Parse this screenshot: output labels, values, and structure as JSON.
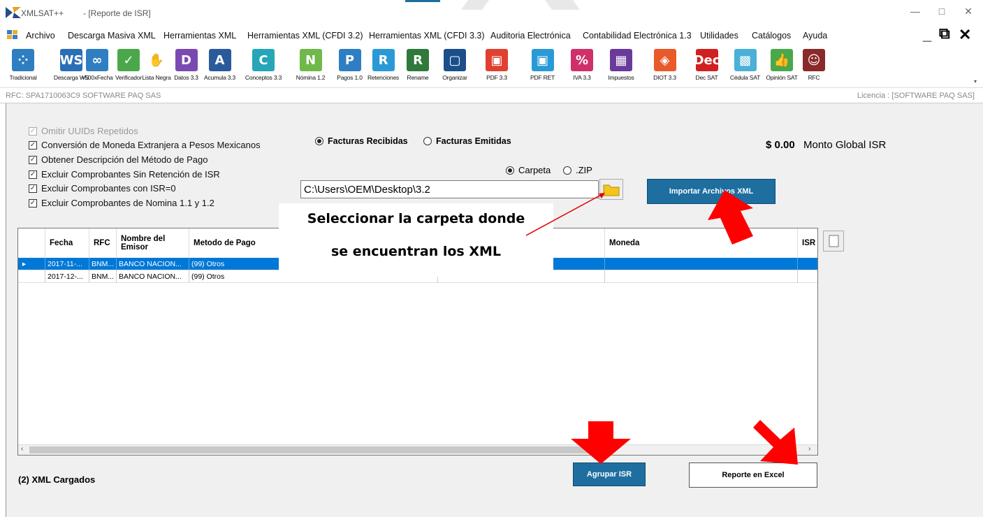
{
  "window": {
    "app_name": "XMLSAT++",
    "doc_title": "- [Reporte de ISR]",
    "minimize": "—",
    "restore": "□",
    "close": "✕"
  },
  "menu": [
    "Archivo",
    "Descarga Masiva XML",
    "Herramientas XML",
    "Herramientas XML (CFDI 3.2)",
    "Herramientas XML (CFDI 3.3)",
    "Auditoria Electrónica",
    "Contabilidad Electrónica 1.3",
    "Utilidades",
    "Catálogos",
    "Ayuda"
  ],
  "toolbar": [
    {
      "label": "Tradicional",
      "glyph": "⁘",
      "color": "#2f7ec1"
    },
    {
      "label": "Descarga WS",
      "glyph": "WS",
      "color": "#2a6fb5"
    },
    {
      "label": "+500xFecha",
      "glyph": "∞",
      "color": "#2f7ec1"
    },
    {
      "label": "Verificador",
      "glyph": "✓",
      "color": "#4aa84a"
    },
    {
      "label": "Lista Negra",
      "glyph": "✋",
      "color": "#ffffff"
    },
    {
      "label": "Datos 3.3",
      "glyph": "D",
      "color": "#7a4ab0"
    },
    {
      "label": "Acumula 3.3",
      "glyph": "A",
      "color": "#2a5a9a"
    },
    {
      "label": "Conceptos 3.3",
      "glyph": "C",
      "color": "#26a6b8"
    },
    {
      "label": "Nómina 1.2",
      "glyph": "N",
      "color": "#6fb84a"
    },
    {
      "label": "Pagos 1.0",
      "glyph": "P",
      "color": "#2f7ec1"
    },
    {
      "label": "Retenciones",
      "glyph": "R",
      "color": "#2a9ad6"
    },
    {
      "label": "Rename",
      "glyph": "R",
      "color": "#2f7a3a"
    },
    {
      "label": "Organizar",
      "glyph": "▢",
      "color": "#1b4f8a"
    },
    {
      "label": "PDF 3.3",
      "glyph": "▣",
      "color": "#e04030"
    },
    {
      "label": "PDF RET",
      "glyph": "▣",
      "color": "#2a9ad6"
    },
    {
      "label": "IVA 3.3",
      "glyph": "%",
      "color": "#d0306a"
    },
    {
      "label": "Impuestos",
      "glyph": "▦",
      "color": "#6a3a9a"
    },
    {
      "label": "DIOT 3.3",
      "glyph": "◈",
      "color": "#e85a2a"
    },
    {
      "label": "Dec SAT",
      "glyph": "Dec",
      "color": "#d02020"
    },
    {
      "label": "Cédula SAT",
      "glyph": "▩",
      "color": "#4ab0d8"
    },
    {
      "label": "Opinión SAT",
      "glyph": "👍",
      "color": "#4aa84a"
    },
    {
      "label": "RFC",
      "glyph": "☺",
      "color": "#8a2a2a"
    }
  ],
  "rfc_bar": {
    "rfc": "RFC: SPA1710063C9 SOFTWARE PAQ SAS",
    "license": "Licencia : [SOFTWARE PAQ SAS]"
  },
  "options": [
    {
      "label": "Omitir UUIDs Repetidos",
      "checked": true,
      "disabled": true
    },
    {
      "label": "Conversión de Moneda Extranjera a Pesos Mexicanos",
      "checked": true,
      "disabled": false
    },
    {
      "label": "Obtener Descripción del Método de Pago",
      "checked": true,
      "disabled": false
    },
    {
      "label": "Excluir Comprobantes Sin Retención de ISR",
      "checked": true,
      "disabled": false
    },
    {
      "label": "Excluir Comprobantes con ISR=0",
      "checked": true,
      "disabled": false
    },
    {
      "label": "Excluir Comprobantes de Nomina 1.1 y 1.2",
      "checked": true,
      "disabled": false
    }
  ],
  "invoice_type": {
    "received": "Facturas Recibidas",
    "issued": "Facturas Emitidas",
    "selected": "received"
  },
  "source_type": {
    "folder": "Carpeta",
    "zip": ".ZIP",
    "selected": "folder"
  },
  "path_value": "C:\\Users\\OEM\\Desktop\\3.2",
  "import_button": "Importar Archivos  XML",
  "total": {
    "amount": "$ 0.00",
    "label": "Monto Global ISR"
  },
  "grid": {
    "columns": [
      "Fecha",
      "RFC",
      "Nombre del Emisor",
      "Metodo de Pago",
      "Moneda",
      "ISR"
    ],
    "rows": [
      {
        "fecha": "2017-11-...",
        "rfc": "BNM...",
        "nombre": "BANCO NACION...",
        "metodo": "(99) Otros",
        "moneda": "",
        "selected": true
      },
      {
        "fecha": "2017-12-...",
        "rfc": "BNM...",
        "nombre": "BANCO NACION...",
        "metodo": "(99) Otros",
        "moneda": "",
        "selected": false
      }
    ]
  },
  "loaded_count": "(2) XML Cargados",
  "agrupar_button": "Agrupar ISR",
  "excel_button": "Reporte en Excel",
  "callout": {
    "line1": "Seleccionar la carpeta donde",
    "line2": "se encuentran los XML"
  },
  "colors": {
    "accent_blue": "#1e6fa0",
    "selection_blue": "#0078d7",
    "arrow_red": "#ff0000"
  }
}
